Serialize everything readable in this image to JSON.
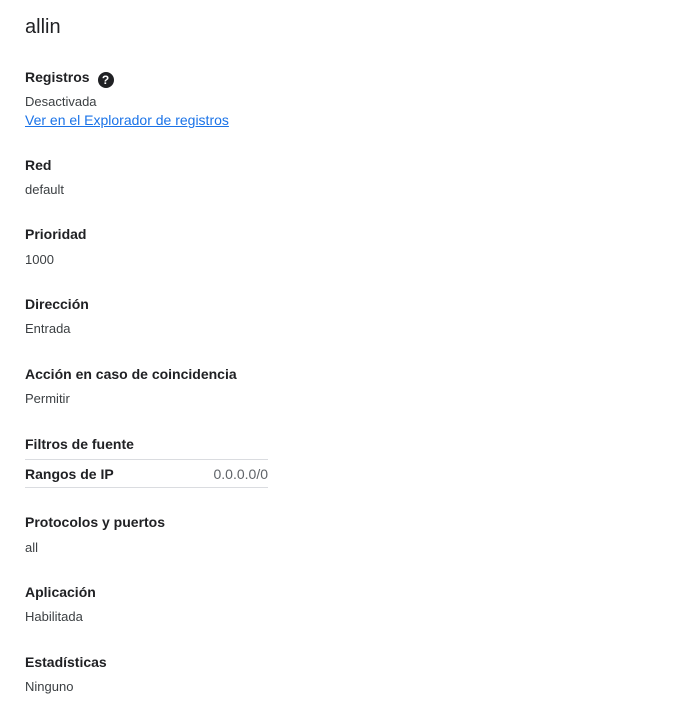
{
  "title": "allin",
  "logs": {
    "label": "Registros",
    "help_icon": "help-circle-icon",
    "value": "Desactivada",
    "link": "Ver en el Explorador de registros"
  },
  "network": {
    "label": "Red",
    "value": "default"
  },
  "priority": {
    "label": "Prioridad",
    "value": "1000"
  },
  "direction": {
    "label": "Dirección",
    "value": "Entrada"
  },
  "action": {
    "label": "Acción en caso de coincidencia",
    "value": "Permitir"
  },
  "source_filters": {
    "label": "Filtros de fuente",
    "rows": [
      {
        "key": "Rangos de IP",
        "value": "0.0.0.0/0"
      }
    ]
  },
  "protocols": {
    "label": "Protocolos y puertos",
    "value": "all"
  },
  "enforcement": {
    "label": "Aplicación",
    "value": "Habilitada"
  },
  "statistics": {
    "label": "Estadísticas",
    "value": "Ninguno"
  },
  "colors": {
    "link": "#1a73e8",
    "text": "#202124",
    "divider": "#dadce0"
  }
}
